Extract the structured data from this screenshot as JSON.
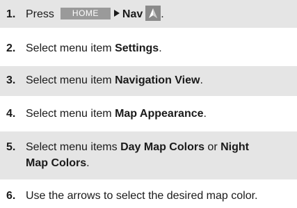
{
  "steps": [
    {
      "num": "1.",
      "prefix": "Press",
      "home_button": "HOME",
      "nav_label": "Nav",
      "suffix": "."
    },
    {
      "num": "2.",
      "prefix": "Select menu item ",
      "bold": "Settings",
      "suffix": "."
    },
    {
      "num": "3.",
      "prefix": "Select menu item ",
      "bold": "Navigation View",
      "suffix": "."
    },
    {
      "num": "4.",
      "prefix": "Select menu item ",
      "bold": "Map Appearance",
      "suffix": "."
    },
    {
      "num": "5.",
      "prefix": "Select menu items ",
      "bold": "Day Map Colors",
      "middle": " or ",
      "bold2": "Night",
      "bold2_cont": "Map Colors",
      "suffix": "."
    },
    {
      "num": "6.",
      "text": "Use the arrows to select the desired map color."
    }
  ],
  "icons": {
    "nav": "navigation-arrow-icon",
    "arrow": "right-triangle-icon"
  },
  "colors": {
    "band": "#e5e5e5",
    "home_button_bg": "#9a9a9a",
    "nav_icon_bg": "#8a8a8a"
  }
}
